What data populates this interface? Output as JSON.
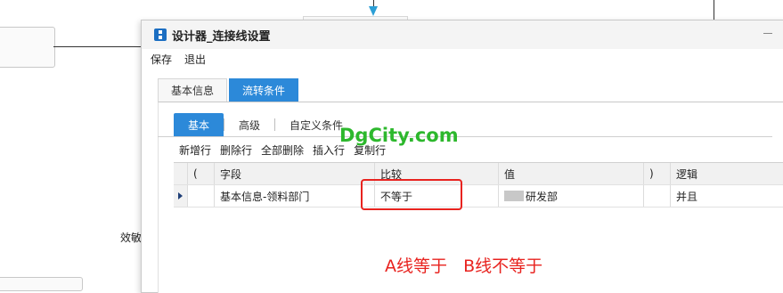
{
  "background": {
    "partial_label": "效敏"
  },
  "dialog": {
    "title": "设计器_连接线设置",
    "menu": [
      "保存",
      "退出"
    ],
    "outer_tabs": [
      "基本信息",
      "流转条件"
    ],
    "inner_tabs": [
      "基本",
      "高级",
      "自定义条件"
    ],
    "toolbar": [
      "新增行",
      "删除行",
      "全部删除",
      "插入行",
      "复制行"
    ],
    "grid": {
      "columns": [
        "(",
        "字段",
        "比较",
        "值",
        ")",
        "逻辑"
      ],
      "rows": [
        {
          "lparen": "",
          "field": "基本信息-领料部门",
          "compare": "不等于",
          "value": "研发部",
          "rparen": "",
          "logic": "并且"
        }
      ]
    }
  },
  "watermark": "DgCity.com",
  "annotation": "A线等于   B线不等于",
  "colors": {
    "accent": "#2c89d9",
    "highlight": "#e8231f",
    "watermark": "#2db82d"
  }
}
